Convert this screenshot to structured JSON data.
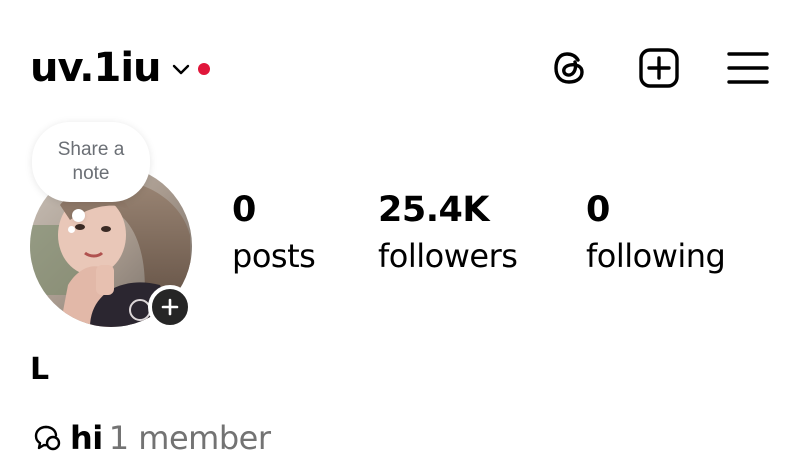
{
  "header": {
    "username": "uv.1iu",
    "notification_dot_color": "#e0163a",
    "icons": [
      "threads-icon",
      "add-post-icon",
      "menu-icon"
    ]
  },
  "profile": {
    "note_prompt": "Share a note",
    "avatar_icon": "profile-photo",
    "add_story_icon": "plus-icon",
    "display_name": "L"
  },
  "stats": {
    "posts": {
      "value": "0",
      "label": "posts"
    },
    "followers": {
      "value": "25.4K",
      "label": "followers"
    },
    "following": {
      "value": "0",
      "label": "following"
    }
  },
  "channel": {
    "icon": "broadcast-channel-icon",
    "name": "hi",
    "members": "1 member",
    "members_color": "#737373"
  }
}
